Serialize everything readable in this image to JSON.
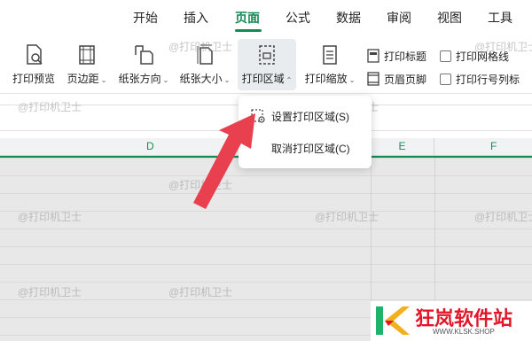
{
  "menu": {
    "tabs": [
      {
        "label": "开始",
        "active": false
      },
      {
        "label": "插入",
        "active": false
      },
      {
        "label": "页面",
        "active": true
      },
      {
        "label": "公式",
        "active": false
      },
      {
        "label": "数据",
        "active": false
      },
      {
        "label": "审阅",
        "active": false
      },
      {
        "label": "视图",
        "active": false
      },
      {
        "label": "工具",
        "active": false
      }
    ]
  },
  "ribbon": {
    "print_preview": "打印预览",
    "margins": "页边距",
    "orientation": "纸张方向",
    "paper_size": "纸张大小",
    "print_area": "打印区域",
    "print_scaling": "打印缩放",
    "print_titles": "打印标题",
    "header_footer": "页眉页脚",
    "print_gridlines": "打印网格线",
    "print_row_col_headers": "打印行号列标"
  },
  "columns": {
    "d": "D",
    "e": "E",
    "f": "F"
  },
  "dropdown": {
    "set_print_area": "设置打印区域(S)",
    "clear_print_area": "取消打印区域(C)"
  },
  "watermark": "@打印机卫士",
  "logo": {
    "brand": "狂岚软件站",
    "site": "WWW.KLSK.SHOP"
  },
  "colors": {
    "accent": "#148a54",
    "arrow": "#e8404e",
    "logo": "#e0182a"
  }
}
